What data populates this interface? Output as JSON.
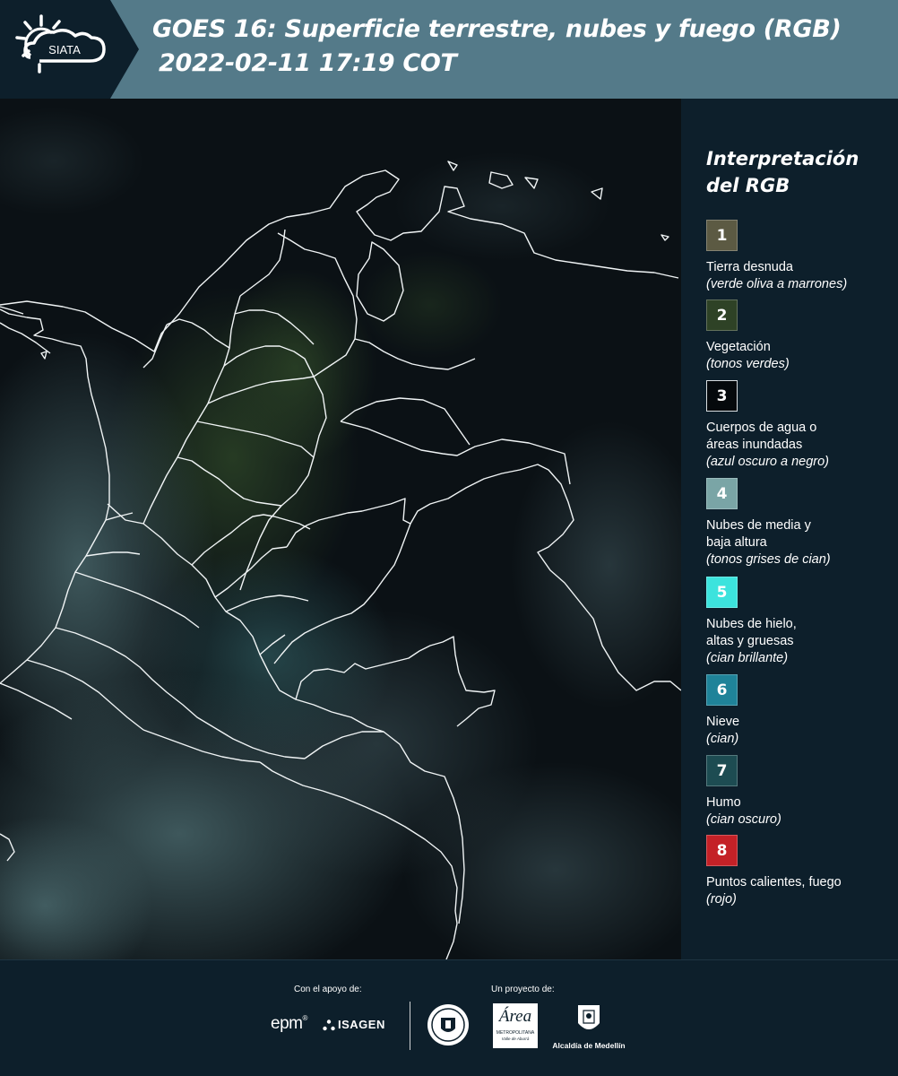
{
  "header": {
    "logo_text": "SIATA",
    "title_line1": "GOES 16: Superficie terrestre, nubes y fuego (RGB)",
    "title_line2": "2022-02-11 17:19 COT"
  },
  "legend": {
    "title_line1": "Interpretación",
    "title_line2": "del RGB",
    "items": [
      {
        "number": "1",
        "label_line1": "Tierra desnuda",
        "label_line2": "",
        "desc": "(verde oliva a marrones)",
        "color": "#5c5a43"
      },
      {
        "number": "2",
        "label_line1": "Vegetación",
        "label_line2": "",
        "desc": "(tonos verdes)",
        "color": "#2e4226"
      },
      {
        "number": "3",
        "label_line1": "Cuerpos de agua o",
        "label_line2": "áreas inundadas",
        "desc": "(azul oscuro a negro)",
        "color": "#05090c"
      },
      {
        "number": "4",
        "label_line1": "Nubes de media y",
        "label_line2": "baja altura",
        "desc": "(tonos grises de cian)",
        "color": "#7aa5a6"
      },
      {
        "number": "5",
        "label_line1": "Nubes de hielo,",
        "label_line2": "altas y gruesas",
        "desc": "(cian brillante)",
        "color": "#3ce3dd"
      },
      {
        "number": "6",
        "label_line1": "Nieve",
        "label_line2": "",
        "desc": "(cian)",
        "color": "#1f8399"
      },
      {
        "number": "7",
        "label_line1": "Humo",
        "label_line2": "",
        "desc": "(cian oscuro)",
        "color": "#1d4c52"
      },
      {
        "number": "8",
        "label_line1": "Puntos calientes, fuego",
        "label_line2": "",
        "desc": "(rojo)",
        "color": "#c42127"
      }
    ]
  },
  "footer": {
    "support_label": "Con el apoyo de:",
    "project_label": "Un proyecto de:",
    "sponsor_epm": "epm",
    "sponsor_isagen": "ISAGEN",
    "sponsor_area": "Área",
    "sponsor_area_sub": "METROPOLITANA",
    "sponsor_area_sub2": "Valle de Aburrá",
    "sponsor_alcaldia": "Alcaldía de Medellín"
  }
}
